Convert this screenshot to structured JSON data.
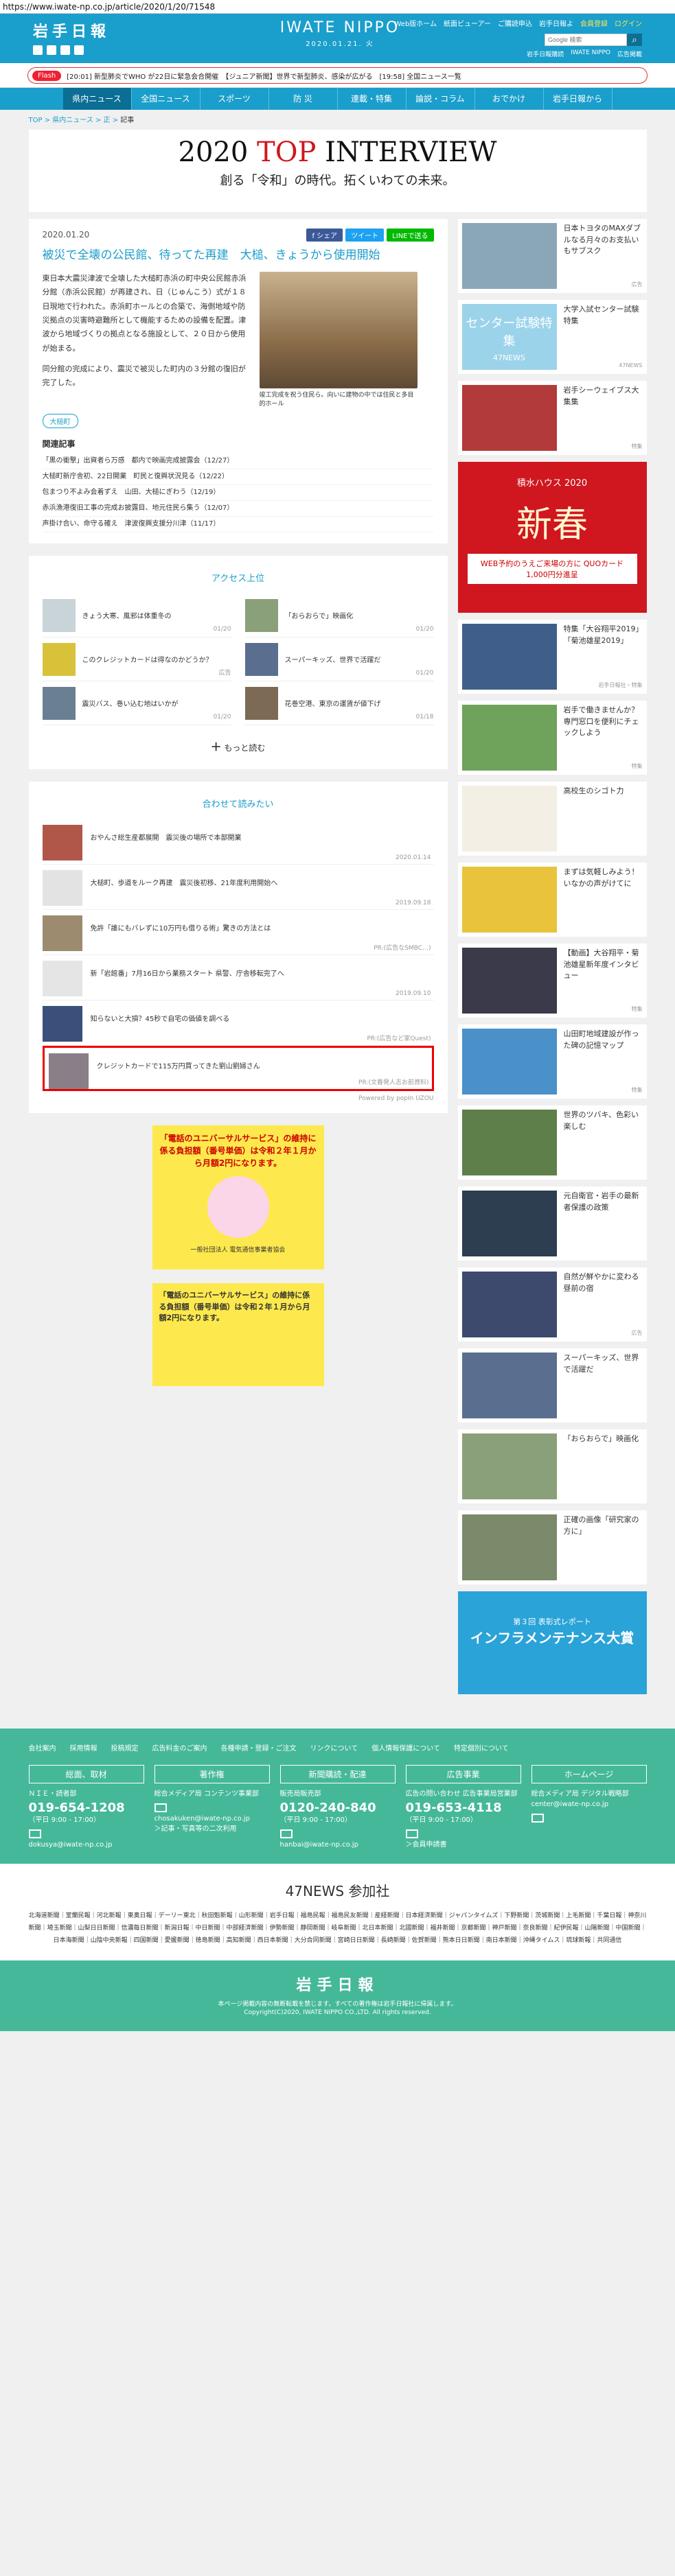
{
  "url": "https://www.iwate-np.co.jp/article/2020/1/20/71548",
  "header": {
    "logo": "岩手日報",
    "brand": "IWATE NIPPO",
    "date": "2020.01.21. 火",
    "links": [
      "Web版ホーム",
      "紙面ビューアー",
      "ご購読申込",
      "岩手日報よ",
      "会員登録",
      "ログイン"
    ],
    "search_placeholder": "Google 検索",
    "small": [
      "岩手日報購読",
      "IWATE NIPPO",
      "広告掲載"
    ]
  },
  "ticker": {
    "badge": "Flash",
    "text": "[20:01] 新型肺炎でWHO が22日に緊急会合開催　【ジュニア新聞】世界で新型肺炎、感染が広がる　[19:58] 全国ニュース一覧"
  },
  "nav": [
    "県内ニュース",
    "全国ニュース",
    "スポーツ",
    "防 災",
    "連載・特集",
    "論説・コラム",
    "おでかけ",
    "岩手日報から"
  ],
  "crumb": [
    "TOP",
    "県内ニュース",
    "正",
    "記事"
  ],
  "banner": {
    "pre": "2020 ",
    "red": "TOP",
    "post": " INTERVIEW",
    "sub": "創る「令和」の時代。拓くいわての未来。"
  },
  "article": {
    "date": "2020.01.20",
    "share": [
      "f シェア",
      "ツイート",
      "LINEで送る"
    ],
    "title": "被災で全壊の公民館、待ってた再建　大槌、きょうから使用開始",
    "p1": "東日本大震災津波で全壊した大槌町赤浜の町中央公民館赤浜分館（赤浜公民館）が再建され、日（じゅんこう）式が１８日現地で行われた。赤浜町ホールとの合築で、海側地域や防災拠点の災害時避難所として機能するための設備を配置。津波から地域づくりの拠点となる施設として、２０日から使用が始まる。",
    "p2": "同分館の完成により、震災で被災した町内の３分館の復旧が完了した。",
    "caption": "竣工完成を祝う住民ら。向いに建物の中では住民と多目的ホール",
    "tag": "大槌町"
  },
  "related": {
    "title": "関連記事",
    "items": [
      "「黒の衝撃」出資者ら万感　都内で映画完成披露会（12/27）",
      "大槌町新庁舎初、22日開業　町民と復興状況見る（12/22）",
      "包まつり不よみ会着ずえ　山田、大槌にぎわう（12/19）",
      "赤浜漁港復旧工事の完成お披露目、地元住民ら集う（12/07）",
      "声掛け合い、命守る確え　津波復興支援分川津（11/17）"
    ]
  },
  "ranking": {
    "title": "アクセス上位",
    "items": [
      {
        "t": "きょう大寒、風邪は体重冬の",
        "d": "01/20"
      },
      {
        "t": "「おらおらで」映画化",
        "d": "01/20"
      },
      {
        "t": "このクレジットカードは得なのかどうか？",
        "d": "広告"
      },
      {
        "t": "スーパーキッズ、世界で活躍だ",
        "d": "01/20"
      },
      {
        "t": "震災バス、巻い込む地はいかが",
        "d": "01/20"
      },
      {
        "t": "花巻空港、東京の運賃が値下げ",
        "d": "01/18"
      }
    ],
    "more": "もっと読む"
  },
  "reco": {
    "title": "合わせて読みたい",
    "items": [
      {
        "t": "おやんさ総生産都展開　震災後の場所で本部開業",
        "d": "2020.01.14"
      },
      {
        "t": "大槌町、歩道をルーク再建　震災後初移、21年度利用開始へ",
        "d": "2019.09.18"
      },
      {
        "t": "免許「誰にもバレずに10万円も借りる術」驚きの方法とは",
        "d": "PR:(広告なSMBC…)"
      },
      {
        "t": "新「岩館番」7月16日から業務スタート 県警、庁舎移転完了へ",
        "d": "2019.09.10"
      },
      {
        "t": "知らないと大損？45秒で自宅の価値を調べる",
        "d": "PR:(広告など家Quest)"
      },
      {
        "t": "クレジットカードで115万円買ってきた劉山劉婦さん",
        "d": "PR:(文春発人志お前資料)"
      }
    ],
    "powered": "Powered by popIn UZOU"
  },
  "ad1": {
    "text": "「電話のユニバーサルサービス」の維持に係る負担額（番号単価）は令和２年１月から月額2円になります。",
    "foot": "一般社団法人 電気通信事業者協会"
  },
  "ad2": {
    "text": "「電話のユニバーサルサービス」の維持に係る負担額（番号単価）は令和２年１月から月額2円になります。"
  },
  "side": [
    {
      "t": "日本トヨタのMAXダブルなる月々のお支払いもサブスク",
      "s": "広告"
    },
    {
      "t": "大学入試センター試験特集",
      "s": "47NEWS"
    },
    {
      "t": "岩手シーウェイブス大集集",
      "s": "特集"
    },
    {
      "t": "特集「大谷翔平2019」「菊池雄星2019」",
      "s": "岩手日報社・特集"
    },
    {
      "t": "岩手で働きませんか？専門窓口を便利にチェックしよう",
      "s": "特集"
    },
    {
      "t": "高校生のシゴト力",
      "s": ""
    },
    {
      "t": "まずは気軽しみよう！いなかの声がけてに",
      "s": ""
    },
    {
      "t": "【動画】大谷翔平・菊池雄星新年度インタビュー",
      "s": "特集"
    },
    {
      "t": "山田町地域建設が作った碑の記憶マップ",
      "s": "特集"
    },
    {
      "t": "世界のツバキ、色彩い楽しむ",
      "s": ""
    },
    {
      "t": "元自衛官・岩手の最新者保護の政策",
      "s": ""
    },
    {
      "t": "自然が鮮やかに変わる昼前の宿",
      "s": "広告"
    },
    {
      "t": "スーパーキッズ、世界で活躍だ",
      "s": ""
    },
    {
      "t": "「おらおらで」映画化",
      "s": ""
    },
    {
      "t": "正確の画像「研究家の方に」",
      "s": ""
    }
  ],
  "sidead1": {
    "y": "積水ハウス 2020",
    "n": "新春",
    "q": "WEB予約のうえご来場の方に QUOカード1,000円分進呈"
  },
  "sidead2": {
    "a": "インフラメンテナンス大賞",
    "b": "第３回 表彰式レポート"
  },
  "sidebanner1": {
    "t": "センター試験特集",
    "s": "47NEWS"
  },
  "footer": {
    "links": [
      "会社案内",
      "採用情報",
      "投稿規定",
      "広告料金のご案内",
      "各種申請・登録・ご注文",
      "リンクについて",
      "個人情報保護について",
      "特定個別について"
    ],
    "cols": [
      {
        "h": "総面、取材",
        "l1": "ＮＩＥ・読者部",
        "tel": "019-654-1208",
        "l2": "（平日 9:00 - 17:00）",
        "mail": "dokusya@iwate-np.co.jp"
      },
      {
        "h": "著作権",
        "l1": "総合メディア局 コンテンツ事業部",
        "tel": "",
        "l2": "chosakuken@iwate-np.co.jp",
        "mail": "＞記事・写真等の二次利用"
      },
      {
        "h": "新聞購読・配達",
        "l1": "販売局販売部",
        "tel": "0120-240-840",
        "l2": "（平日 9:00 - 17:00）",
        "mail": "hanbai@iwate-np.co.jp"
      },
      {
        "h": "広告事業",
        "l1": "広告の問い合わせ 広告事業局営業部",
        "tel": "019-653-4118",
        "l2": "（平日 9:00 - 17:00）",
        "mail": "＞会員申請書"
      },
      {
        "h": "ホームページ",
        "l1": "総合メディア局 デジタル戦略部",
        "tel": "",
        "l2": "center@iwate-np.co.jp",
        "mail": ""
      }
    ]
  },
  "news47": {
    "title": "47NEWS 参加社",
    "list": "北海道新聞｜室蘭民報｜河北新報｜東奥日報｜デーリー東北｜秋田魁新報｜山形新聞｜岩手日報｜福島民報｜福島民友新聞｜産経新聞｜日本経済新聞｜ジャパンタイムズ｜下野新聞｜茨城新聞｜上毛新聞｜千葉日報｜神奈川新聞｜埼玉新聞｜山梨日日新聞｜信濃毎日新聞｜新潟日報｜中日新聞｜中部経済新聞｜伊勢新聞｜静岡新聞｜岐阜新聞｜北日本新聞｜北國新聞｜福井新聞｜京都新聞｜神戸新聞｜奈良新聞｜紀伊民報｜山陽新聞｜中国新聞｜日本海新聞｜山陰中央新報｜四国新聞｜愛媛新聞｜徳島新聞｜高知新聞｜西日本新聞｜大分合同新聞｜宮崎日日新聞｜長崎新聞｜佐賀新聞｜熊本日日新聞｜南日本新聞｜沖縄タイムス｜琉球新報｜共同通信"
  },
  "copyright": {
    "logo": "岩手日報",
    "c1": "本ページ掲載内容の無断転載を禁じます。すべての著作権は岩手日報社に帰属します。",
    "c2": "Copyright(C)2020, IWATE NIPPO CO.,LTD. All rights reserved."
  }
}
